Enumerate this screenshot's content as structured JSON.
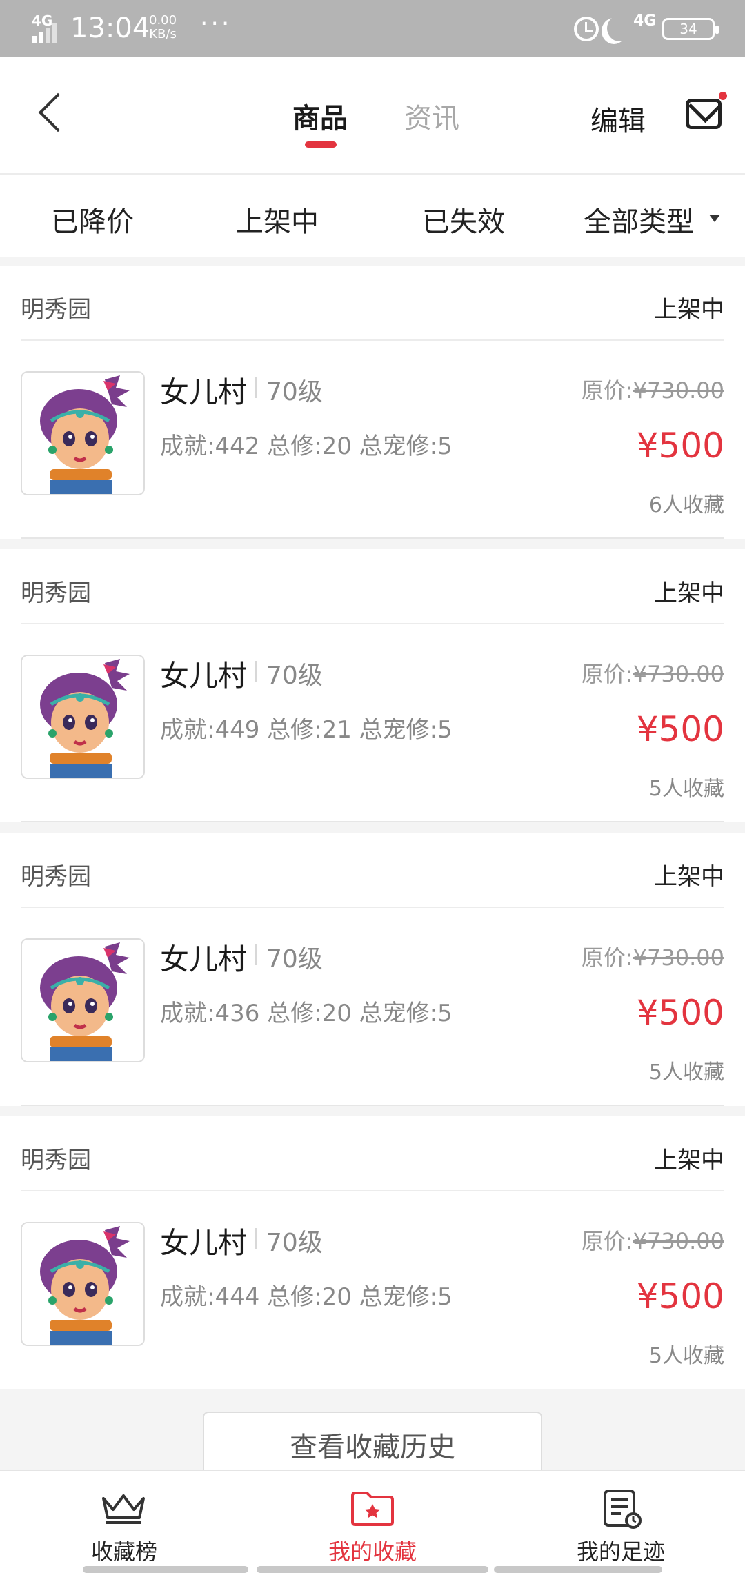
{
  "status_bar": {
    "network": "4G",
    "time": "13:04",
    "speed_value": "0.00",
    "speed_unit": "KB/s",
    "more": "···",
    "network_right": "4G",
    "battery": "34"
  },
  "header": {
    "tabs": [
      {
        "label": "商品",
        "active": true
      },
      {
        "label": "资讯",
        "active": false
      }
    ],
    "edit_label": "编辑",
    "mail_icon": "mail-icon"
  },
  "filters": [
    {
      "label": "已降价"
    },
    {
      "label": "上架中"
    },
    {
      "label": "已失效"
    },
    {
      "label": "全部类型"
    }
  ],
  "items": [
    {
      "shop": "明秀园",
      "state": "上架中",
      "name": "女儿村",
      "level": "70级",
      "stats": "成就:442 总修:20 总宠修:5",
      "orig_label": "原价:",
      "orig_price": "¥730.00",
      "price": "¥500",
      "favs": "6人收藏"
    },
    {
      "shop": "明秀园",
      "state": "上架中",
      "name": "女儿村",
      "level": "70级",
      "stats": "成就:449 总修:21 总宠修:5",
      "orig_label": "原价:",
      "orig_price": "¥730.00",
      "price": "¥500",
      "favs": "5人收藏"
    },
    {
      "shop": "明秀园",
      "state": "上架中",
      "name": "女儿村",
      "level": "70级",
      "stats": "成就:436 总修:20 总宠修:5",
      "orig_label": "原价:",
      "orig_price": "¥730.00",
      "price": "¥500",
      "favs": "5人收藏"
    },
    {
      "shop": "明秀园",
      "state": "上架中",
      "name": "女儿村",
      "level": "70级",
      "stats": "成就:444 总修:20 总宠修:5",
      "orig_label": "原价:",
      "orig_price": "¥730.00",
      "price": "¥500",
      "favs": "5人收藏"
    }
  ],
  "history_button": "查看收藏历史",
  "bottom_nav": [
    {
      "label": "收藏榜",
      "icon": "crown-icon",
      "active": false
    },
    {
      "label": "我的收藏",
      "icon": "folder-star-icon",
      "active": true
    },
    {
      "label": "我的足迹",
      "icon": "footprint-doc-icon",
      "active": false
    }
  ],
  "colors": {
    "accent": "#e3343f",
    "status_bar": "#b4b4b4",
    "text_muted": "#888888"
  }
}
